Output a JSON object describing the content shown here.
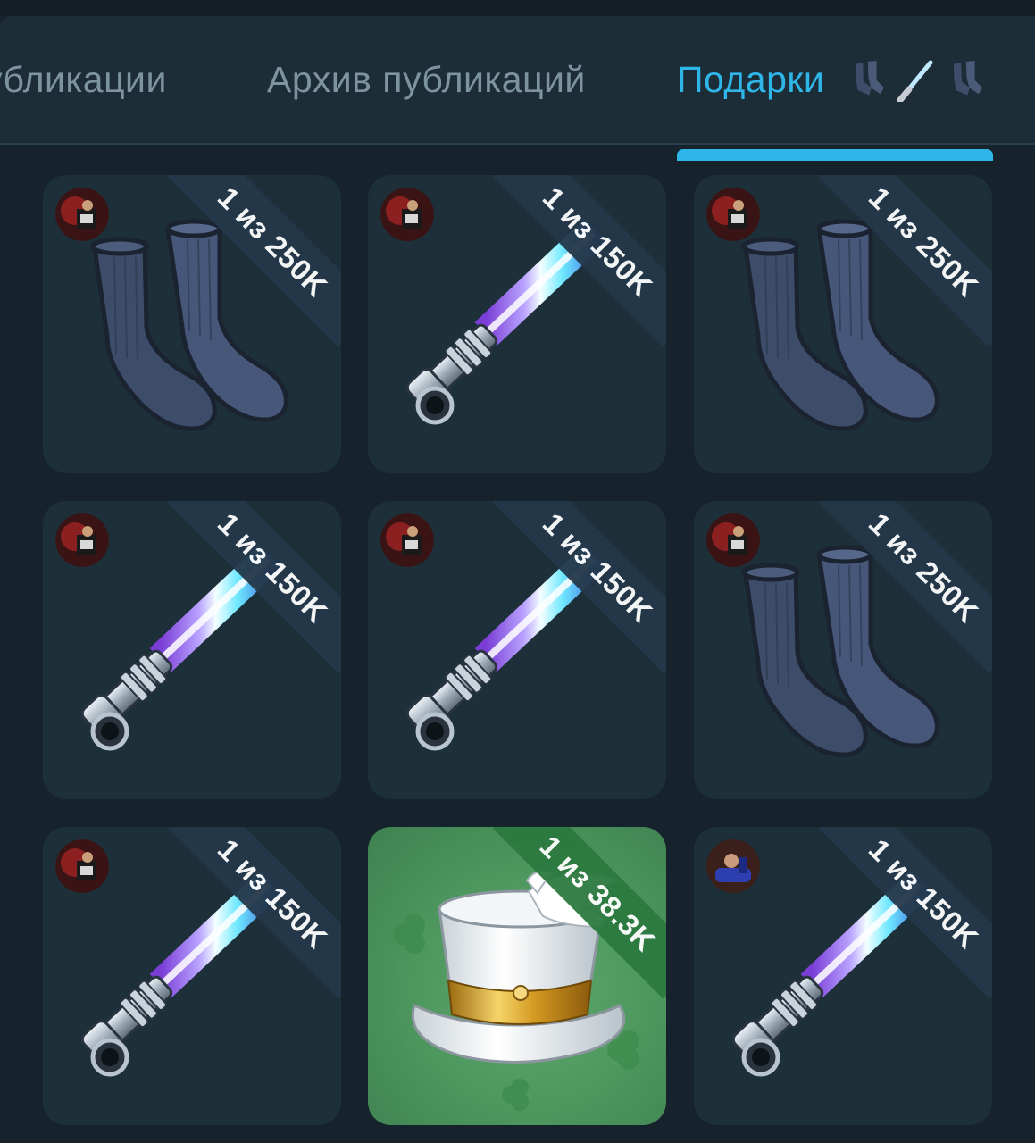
{
  "tabs": [
    {
      "label": "убликации"
    },
    {
      "label": "Архив публикаций"
    },
    {
      "label": "Подарки"
    }
  ],
  "active_tab": "Подарки",
  "tab_icons": [
    "socks-icon",
    "lightsaber-icon",
    "socks-icon"
  ],
  "colors": {
    "background": "#16232c",
    "tab_bar": "#1c2d37",
    "accent": "#2fb6e9",
    "card": "#1d2f38",
    "ribbon": "#24384a",
    "ribbon_green": "#2d7a40"
  },
  "gifts": [
    {
      "kind": "socks",
      "badge": "1 из 250K",
      "avatar": "avatar-red"
    },
    {
      "kind": "lightsaber",
      "badge": "1 из 150K",
      "avatar": "avatar-red"
    },
    {
      "kind": "socks",
      "badge": "1 из 250K",
      "avatar": "avatar-red"
    },
    {
      "kind": "lightsaber",
      "badge": "1 из 150K",
      "avatar": "avatar-red"
    },
    {
      "kind": "lightsaber",
      "badge": "1 из 150K",
      "avatar": "avatar-red"
    },
    {
      "kind": "socks",
      "badge": "1 из 250K",
      "avatar": "avatar-red"
    },
    {
      "kind": "lightsaber",
      "badge": "1 из 150K",
      "avatar": "avatar-red"
    },
    {
      "kind": "top-hat",
      "badge": "1 из 38.3K",
      "avatar": ""
    },
    {
      "kind": "lightsaber",
      "badge": "1 из 150K",
      "avatar": "avatar-blue"
    }
  ]
}
